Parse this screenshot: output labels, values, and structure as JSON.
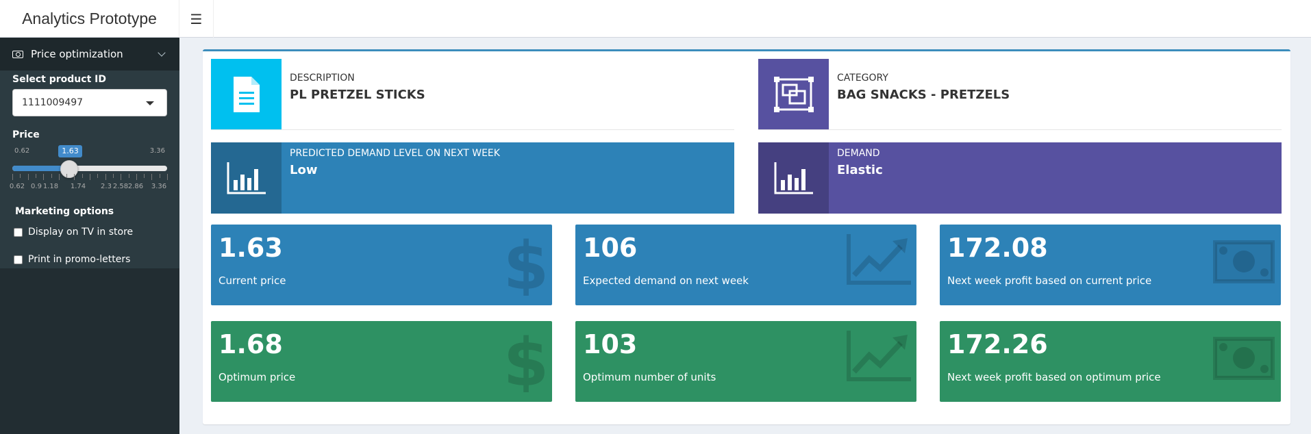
{
  "app": {
    "title": "Analytics Prototype"
  },
  "sidebar": {
    "menu_label": "Price optimization",
    "product_label": "Select product ID",
    "product_value": "1111009497",
    "price_label": "Price",
    "price": {
      "min": 0.62,
      "max": 3.36,
      "value": 1.63,
      "min_label": "0.62",
      "max_label": "3.36",
      "value_label": "1.63"
    },
    "tick_labels": [
      "0.62",
      "0.9",
      "1.18",
      "1.74",
      "2.3",
      "2.58",
      "2.86",
      "3.36"
    ],
    "marketing_label": "Marketing options",
    "options": [
      {
        "label": "Display on TV in store",
        "checked": false
      },
      {
        "label": "Print in promo-letters",
        "checked": false
      }
    ]
  },
  "info": {
    "description": {
      "caption": "DESCRIPTION",
      "value": "PL PRETZEL STICKS",
      "icon": "file-text-icon",
      "color": "#00c0ef"
    },
    "category": {
      "caption": "CATEGORY",
      "value": "BAG SNACKS - PRETZELS",
      "icon": "object-group-icon",
      "color": "#5751a0"
    },
    "demand_level": {
      "caption": "PREDICTED DEMAND LEVEL ON NEXT WEEK",
      "value": "Low",
      "icon": "bar-chart-icon",
      "color": "#2d82b7"
    },
    "demand": {
      "caption": "DEMAND",
      "value": "Elastic",
      "icon": "bar-chart-icon",
      "color": "#5751a0"
    }
  },
  "values": {
    "current_price": {
      "value": "1.63",
      "label": "Current price",
      "icon": "dollar-icon"
    },
    "expected_demand": {
      "value": "106",
      "label": "Expected demand on next week",
      "icon": "line-chart-icon"
    },
    "profit_current": {
      "value": "172.08",
      "label": "Next week profit based on current price",
      "icon": "money-icon"
    },
    "optimum_price": {
      "value": "1.68",
      "label": "Optimum price",
      "icon": "dollar-icon"
    },
    "optimum_units": {
      "value": "103",
      "label": "Optimum number of units",
      "icon": "line-chart-icon"
    },
    "profit_optimum": {
      "value": "172.26",
      "label": "Next week profit based on optimum price",
      "icon": "money-icon"
    }
  },
  "colors": {
    "blue": "#2d82b7",
    "green": "#2e9163",
    "aqua": "#00c0ef",
    "purple": "#5751a0",
    "header_accent": "#3c8dbc"
  }
}
